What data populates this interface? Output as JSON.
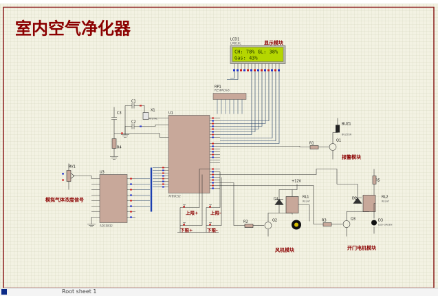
{
  "title": "室内空气净化器",
  "lcd": {
    "ref": "LCD1",
    "part": "LM016L",
    "line1": "CH: 78% GL: 38%",
    "line2": "Gas: 43%",
    "module_label": "显示模块"
  },
  "components": {
    "rp1": "RP1",
    "rp1_part": "RESPACK-8",
    "u1": "U1",
    "u1_part": "AT89C52",
    "u3": "U3",
    "u3_part": "ADC0832",
    "rv1": "RV1",
    "c1": "C1",
    "c2": "C2",
    "c3": "C3",
    "x1": "X1",
    "x1_part": "CRYSTAL",
    "r4": "R4",
    "r1": "R1",
    "r2": "R2",
    "r3": "R3",
    "r5": "R5",
    "q1": "Q1",
    "q2": "Q2",
    "q3": "Q3",
    "buz1": "BUZ1",
    "buz1_part": "BUZZER",
    "d1": "D1",
    "d2": "D2",
    "d3": "D3",
    "d3_part": "LED-GREEN",
    "rl1": "RL1",
    "rl2": "RL2",
    "relay_part": "RELAY",
    "vcc": "+12V"
  },
  "labels": {
    "alarm": "报警模块",
    "gas_signal": "模拟气体浓度信号",
    "up_limit": "上限+",
    "up_limit_minus": "上限-",
    "down_limit": "下限+",
    "down_limit_minus": "下限-",
    "fan": "风机模块",
    "door_motor": "开门电机模块"
  },
  "status": {
    "text": "Root sheet 1"
  }
}
